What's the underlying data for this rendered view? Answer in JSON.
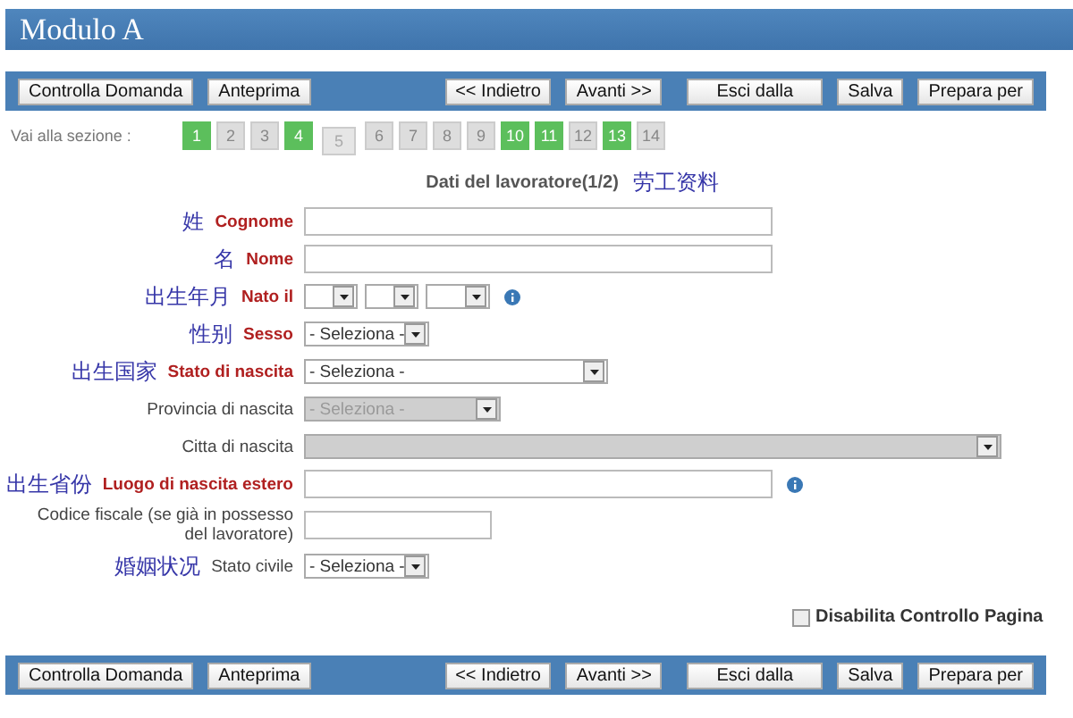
{
  "window": {
    "title": "Modulo A"
  },
  "toolbar_top": [
    {
      "label": "Controlla Domanda"
    },
    {
      "label": "Anteprima"
    },
    {
      "label": "<< Indietro"
    },
    {
      "label": "Avanti >>"
    },
    {
      "label": "Esci dalla"
    },
    {
      "label": "Salva"
    },
    {
      "label": "Prepara per"
    }
  ],
  "sections": {
    "label": "Vai alla sezione :",
    "items": [
      {
        "label": "1",
        "completed": true,
        "selected": false
      },
      {
        "label": "2",
        "completed": false,
        "selected": false
      },
      {
        "label": "3",
        "completed": false,
        "selected": false
      },
      {
        "label": "4",
        "completed": true,
        "selected": false
      },
      {
        "label": "5",
        "completed": false,
        "selected": true
      },
      {
        "label": "6",
        "completed": false,
        "selected": false
      },
      {
        "label": "7",
        "completed": false,
        "selected": false
      },
      {
        "label": "8",
        "completed": false,
        "selected": false
      },
      {
        "label": "9",
        "completed": false,
        "selected": false
      },
      {
        "label": "10",
        "completed": true,
        "selected": false
      },
      {
        "label": "11",
        "completed": true,
        "selected": false
      },
      {
        "label": "12",
        "completed": false,
        "selected": false
      },
      {
        "label": "13",
        "completed": true,
        "selected": false
      },
      {
        "label": "14",
        "completed": false,
        "selected": false
      }
    ]
  },
  "form": {
    "heading": "Dati del lavoratore(1/2)",
    "heading_note": "劳工资料",
    "fields": [
      {
        "note": "姓",
        "label": "Cognome",
        "required": true,
        "kind": "text",
        "disabled": false,
        "help": false
      },
      {
        "note": "名",
        "label": "Nome",
        "required": true,
        "kind": "text",
        "disabled": false,
        "help": false
      },
      {
        "note": "出生年月",
        "label": "Nato il",
        "required": true,
        "kind": "date",
        "disabled": false,
        "help": true
      },
      {
        "note": "性别",
        "label": "Sesso",
        "required": true,
        "kind": "select",
        "value": "- Seleziona -",
        "disabled": false,
        "help": false
      },
      {
        "note": "出生国家",
        "label": "Stato di nascita",
        "required": true,
        "kind": "select",
        "value": "- Seleziona -",
        "disabled": false,
        "help": false
      },
      {
        "label": "Provincia di nascita",
        "required": false,
        "kind": "select",
        "value": "- Seleziona -",
        "disabled": true,
        "help": false
      },
      {
        "label": "Citta di nascita",
        "required": false,
        "kind": "select",
        "disabled": true,
        "help": false
      },
      {
        "note": "出生省份",
        "label": "Luogo di nascita estero",
        "required": true,
        "kind": "text",
        "disabled": false,
        "help": true
      },
      {
        "label": "Codice fiscale (se già in possesso del lavoratore)",
        "required": false,
        "kind": "text",
        "disabled": false,
        "help": false
      },
      {
        "note": "婚姻状况",
        "label": "Stato civile",
        "required": false,
        "kind": "select",
        "value": "- Seleziona -",
        "disabled": false,
        "help": false
      }
    ],
    "option": {
      "label": "Disabilita Controllo Pagina",
      "checked": false
    }
  },
  "toolbar_bottom": [
    {
      "label": "Controlla Domanda"
    },
    {
      "label": "Anteprima"
    },
    {
      "label": "<< Indietro"
    },
    {
      "label": "Avanti >>"
    },
    {
      "label": "Esci dalla"
    },
    {
      "label": "Salva"
    },
    {
      "label": "Prepara per"
    }
  ]
}
